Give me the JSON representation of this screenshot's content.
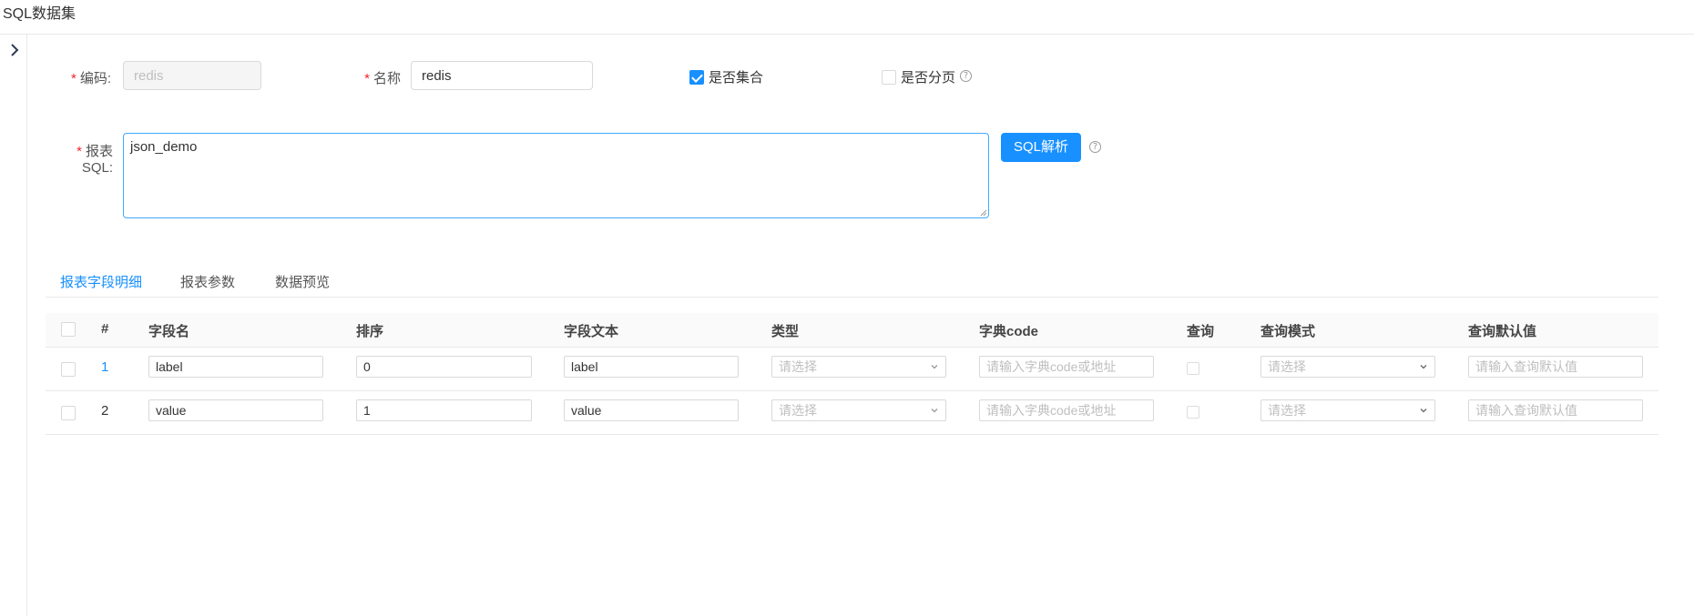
{
  "header": {
    "title": "SQL数据集"
  },
  "form": {
    "code_label": "编码:",
    "code_value": "redis",
    "name_label": "名称",
    "name_value": "redis",
    "is_collection_label": "是否集合",
    "is_collection_checked": true,
    "is_paged_label": "是否分页",
    "is_paged_checked": false,
    "help_glyph": "?",
    "sql_label": "报表SQL:",
    "sql_value": "json_demo",
    "parse_button": "SQL解析"
  },
  "tabs": [
    {
      "label": "报表字段明细",
      "active": true
    },
    {
      "label": "报表参数",
      "active": false
    },
    {
      "label": "数据预览",
      "active": false
    }
  ],
  "table": {
    "columns": [
      "#",
      "字段名",
      "排序",
      "字段文本",
      "类型",
      "字典code",
      "查询",
      "查询模式",
      "查询默认值"
    ],
    "rows": [
      {
        "num": "1",
        "field_name": "label",
        "order": "0",
        "field_text": "label",
        "type_placeholder": "请选择",
        "dict_placeholder": "请输入字典code或地址",
        "query_checked": false,
        "mode_placeholder": "请选择",
        "default_placeholder": "请输入查询默认值"
      },
      {
        "num": "2",
        "field_name": "value",
        "order": "1",
        "field_text": "value",
        "type_placeholder": "请选择",
        "dict_placeholder": "请输入字典code或地址",
        "query_checked": false,
        "mode_placeholder": "请选择",
        "default_placeholder": "请输入查询默认值"
      }
    ]
  },
  "colors": {
    "primary": "#1890ff",
    "required": "#f5222d",
    "border": "#d9d9d9"
  }
}
